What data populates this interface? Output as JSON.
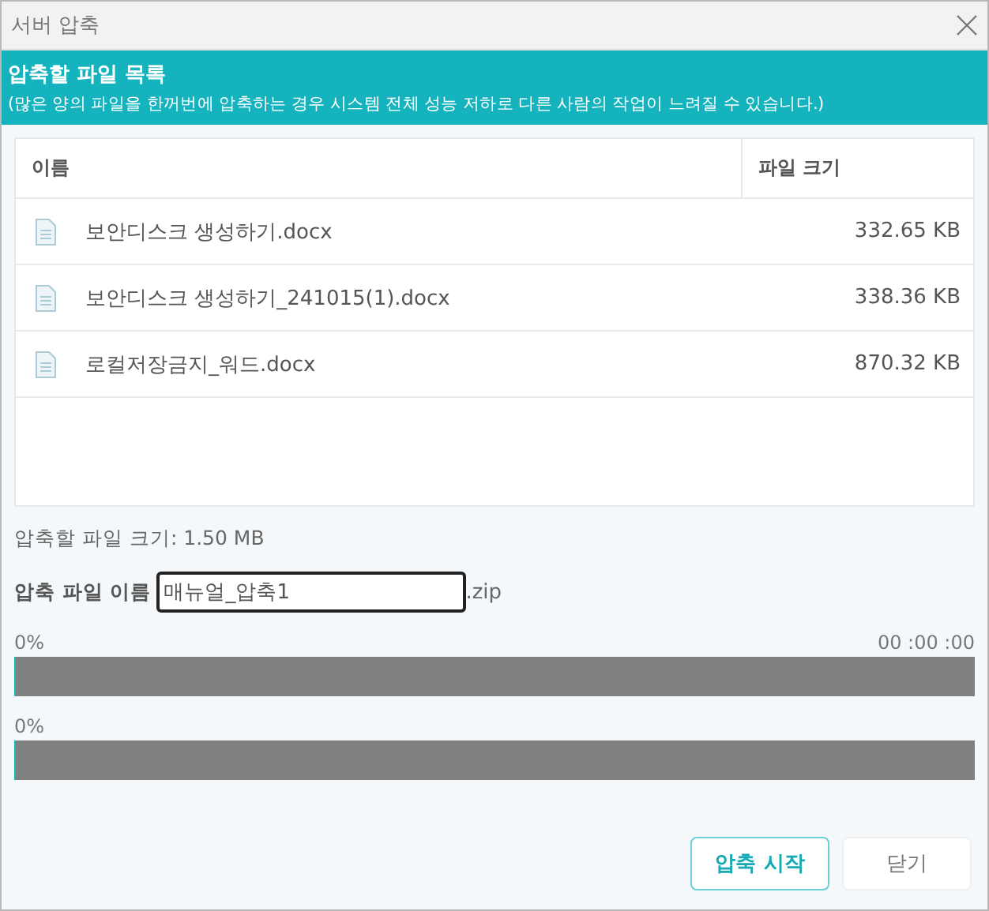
{
  "window": {
    "title": "서버 압축"
  },
  "header": {
    "title": "압축할 파일 목록",
    "note": "(많은 양의 파일을 한꺼번에 압축하는 경우 시스템 전체 성능 저하로 다른 사람의 작업이 느려질 수 있습니다.)"
  },
  "table": {
    "columns": [
      "이름",
      "파일 크기"
    ],
    "rows": [
      {
        "name": "보안디스크 생성하기.docx",
        "size": "332.65 KB"
      },
      {
        "name": "보안디스크 생성하기_241015(1).docx",
        "size": "338.36 KB"
      },
      {
        "name": "로컬저장금지_워드.docx",
        "size": "870.32 KB"
      }
    ]
  },
  "total_size": "압축할 파일 크기: 1.50 MB",
  "archive_name": {
    "label": "압축 파일 이름",
    "value": "매뉴얼_압축1",
    "extension": ".zip"
  },
  "progress": [
    {
      "percent": "0%",
      "time": "00 :00 :00",
      "level": 0
    },
    {
      "percent": "0%",
      "level": 0
    }
  ],
  "buttons": [
    {
      "label": "압축 시작",
      "kind": "primary"
    },
    {
      "label": "닫기",
      "kind": "secondary"
    }
  ]
}
